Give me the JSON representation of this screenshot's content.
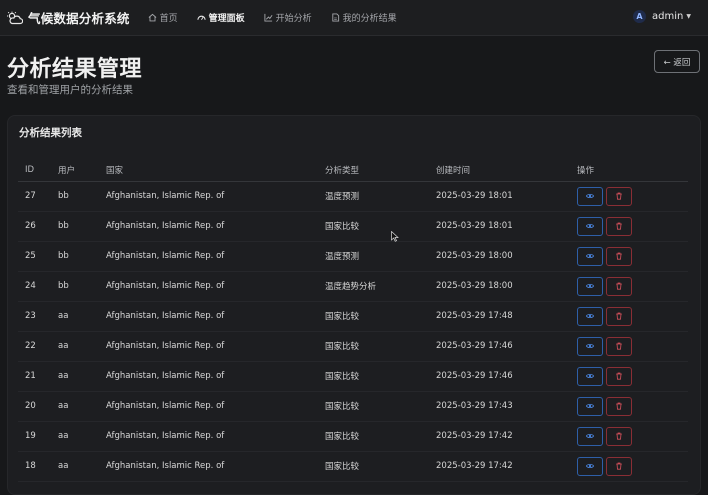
{
  "navbar": {
    "brand": "气候数据分析系统",
    "links": [
      {
        "label": "首页",
        "icon": "home-icon"
      },
      {
        "label": "管理面板",
        "icon": "dashboard-icon",
        "active": true
      },
      {
        "label": "开始分析",
        "icon": "chart-line-icon"
      },
      {
        "label": "我的分析结果",
        "icon": "document-icon"
      }
    ],
    "user": {
      "initial": "A",
      "name": "admin"
    }
  },
  "header": {
    "title": "分析结果管理",
    "subtitle": "查看和管理用户的分析结果",
    "back_label": "← 返回"
  },
  "card": {
    "title": "分析结果列表",
    "columns": [
      "ID",
      "用户",
      "国家",
      "分析类型",
      "创建时间",
      "操作"
    ],
    "rows": [
      {
        "id": "27",
        "user": "bb",
        "country": "Afghanistan, Islamic Rep. of",
        "type": "温度预测",
        "created": "2025-03-29 18:01"
      },
      {
        "id": "26",
        "user": "bb",
        "country": "Afghanistan, Islamic Rep. of",
        "type": "国家比较",
        "created": "2025-03-29 18:01"
      },
      {
        "id": "25",
        "user": "bb",
        "country": "Afghanistan, Islamic Rep. of",
        "type": "温度预测",
        "created": "2025-03-29 18:00"
      },
      {
        "id": "24",
        "user": "bb",
        "country": "Afghanistan, Islamic Rep. of",
        "type": "温度趋势分析",
        "created": "2025-03-29 18:00"
      },
      {
        "id": "23",
        "user": "aa",
        "country": "Afghanistan, Islamic Rep. of",
        "type": "国家比较",
        "created": "2025-03-29 17:48"
      },
      {
        "id": "22",
        "user": "aa",
        "country": "Afghanistan, Islamic Rep. of",
        "type": "国家比较",
        "created": "2025-03-29 17:46"
      },
      {
        "id": "21",
        "user": "aa",
        "country": "Afghanistan, Islamic Rep. of",
        "type": "国家比较",
        "created": "2025-03-29 17:46"
      },
      {
        "id": "20",
        "user": "aa",
        "country": "Afghanistan, Islamic Rep. of",
        "type": "国家比较",
        "created": "2025-03-29 17:43"
      },
      {
        "id": "19",
        "user": "aa",
        "country": "Afghanistan, Islamic Rep. of",
        "type": "国家比较",
        "created": "2025-03-29 17:42"
      },
      {
        "id": "18",
        "user": "aa",
        "country": "Afghanistan, Islamic Rep. of",
        "type": "国家比较",
        "created": "2025-03-29 17:42"
      }
    ]
  },
  "colors": {
    "view": "#2e5fa8",
    "delete": "#8a2e35",
    "background": "#17181a"
  }
}
